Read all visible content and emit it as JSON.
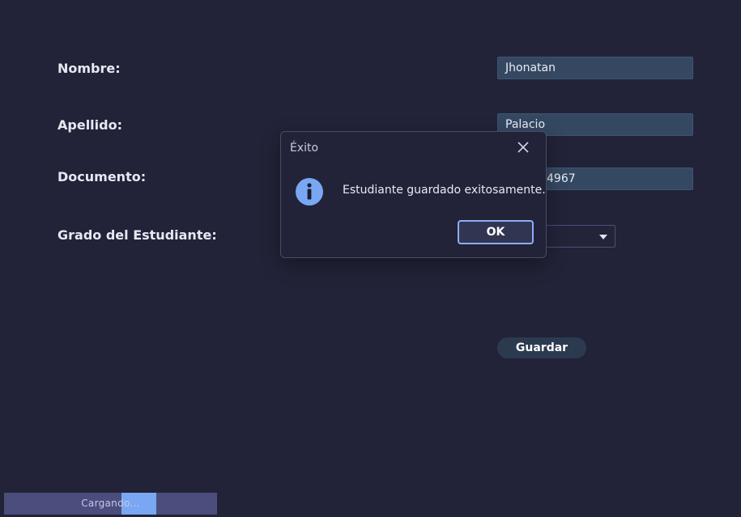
{
  "form": {
    "nombre_label": "Nombre:",
    "nombre_value": "Jhonatan",
    "apellido_label": "Apellido:",
    "apellido_value": "Palacio",
    "documento_label": "Documento:",
    "documento_value_visible": "4967",
    "grado_label": "Grado del Estudiante:",
    "grado_value": "",
    "save_label": "Guardar"
  },
  "progress": {
    "text": "Cargando..."
  },
  "dialog": {
    "title": "Éxito",
    "message": "Estudiante guardado exitosamente.",
    "ok_label": "OK",
    "icon": "info-icon"
  },
  "colors": {
    "background": "#222338",
    "input": "#354861",
    "accent": "#7aa7f3",
    "info_icon": "#7aa7f3"
  }
}
